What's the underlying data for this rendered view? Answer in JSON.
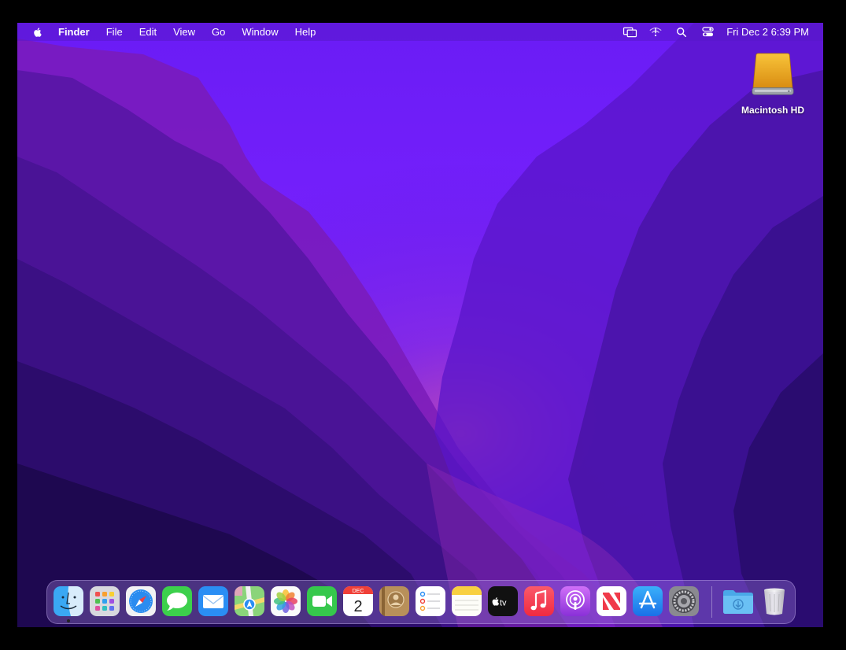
{
  "menubar": {
    "app_name": "Finder",
    "menus": [
      "File",
      "Edit",
      "View",
      "Go",
      "Window",
      "Help"
    ],
    "clock": "Fri Dec 2  6:39 PM"
  },
  "desktop": {
    "icons": [
      {
        "label": "Macintosh HD",
        "icon": "hard-drive-icon"
      }
    ]
  },
  "dock": {
    "apps": [
      {
        "name": "finder",
        "icon": "finder-icon",
        "running": true
      },
      {
        "name": "launchpad",
        "icon": "launchpad-icon"
      },
      {
        "name": "safari",
        "icon": "safari-icon"
      },
      {
        "name": "messages",
        "icon": "messages-icon"
      },
      {
        "name": "mail",
        "icon": "mail-icon"
      },
      {
        "name": "maps",
        "icon": "maps-icon"
      },
      {
        "name": "photos",
        "icon": "photos-icon"
      },
      {
        "name": "facetime",
        "icon": "facetime-icon"
      },
      {
        "name": "calendar",
        "icon": "calendar-icon",
        "month": "DEC",
        "day": "2"
      },
      {
        "name": "contacts",
        "icon": "contacts-icon"
      },
      {
        "name": "reminders",
        "icon": "reminders-icon"
      },
      {
        "name": "notes",
        "icon": "notes-icon"
      },
      {
        "name": "apple-tv",
        "icon": "apple-tv-icon",
        "text": "tv"
      },
      {
        "name": "music",
        "icon": "music-icon"
      },
      {
        "name": "podcasts",
        "icon": "podcasts-icon"
      },
      {
        "name": "news",
        "icon": "news-icon"
      },
      {
        "name": "app-store",
        "icon": "app-store-icon"
      },
      {
        "name": "system-preferences",
        "icon": "gear-icon"
      },
      {
        "name": "downloads",
        "icon": "downloads-folder-icon"
      },
      {
        "name": "trash",
        "icon": "trash-icon"
      }
    ]
  },
  "colors": {
    "menubar": "#5818c8",
    "wallpaper_light": "#7a2cff",
    "wallpaper_dark": "#200a58"
  }
}
